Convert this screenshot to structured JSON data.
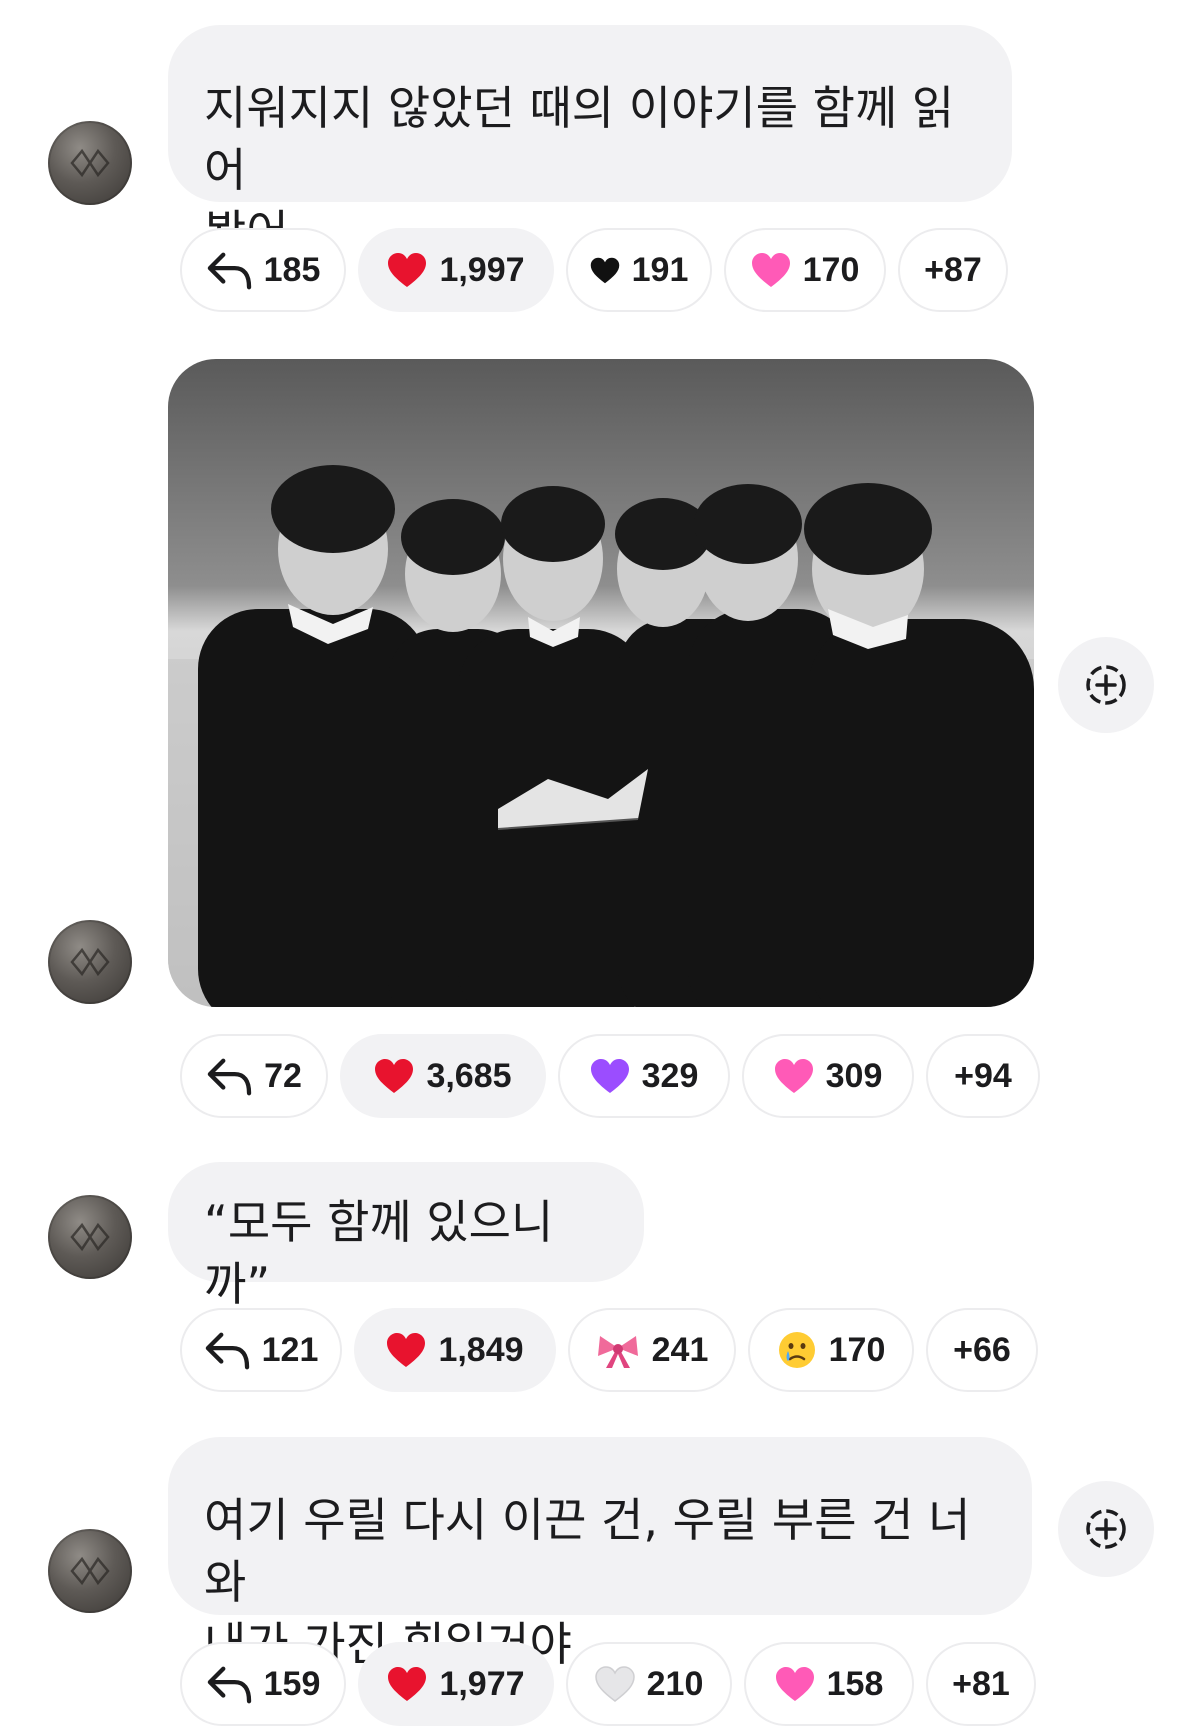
{
  "messages": [
    {
      "text": "지워지지 않았던 때의 이야기를 함께 읽어\n봤어",
      "reactions": {
        "reply": "185",
        "r1": "1,997",
        "r2": "191",
        "r3": "170",
        "more": "+87"
      },
      "icons": [
        "reply-arrow-icon",
        "red-heart-icon",
        "black-heart-icon",
        "sparkling-heart-icon"
      ]
    },
    {
      "image": "group-photo",
      "reactions": {
        "reply": "72",
        "r1": "3,685",
        "r2": "329",
        "r3": "309",
        "more": "+94"
      },
      "icons": [
        "reply-arrow-icon",
        "red-heart-icon",
        "purple-heart-icon",
        "sparkling-heart-icon"
      ]
    },
    {
      "text": "“모두 함께 있으니까”",
      "reactions": {
        "reply": "121",
        "r1": "1,849",
        "r2": "241",
        "r3": "170",
        "more": "+66"
      },
      "icons": [
        "reply-arrow-icon",
        "red-heart-icon",
        "ribbon-icon",
        "crying-face-icon"
      ]
    },
    {
      "text": "여기 우릴 다시 이끈 건, 우릴 부른 건 너와\n내가 가진 힘일거야",
      "reactions": {
        "reply": "159",
        "r1": "1,977",
        "r2": "210",
        "r3": "158",
        "more": "+81"
      },
      "icons": [
        "reply-arrow-icon",
        "red-heart-icon",
        "white-heart-icon",
        "sparkling-heart-icon"
      ]
    }
  ],
  "colors": {
    "bubble": "#f2f2f4",
    "pill_border": "#ececee",
    "heart_red": "#e8132e",
    "heart_purple": "#9b4dff",
    "heart_pink": "#ff5ab7"
  }
}
